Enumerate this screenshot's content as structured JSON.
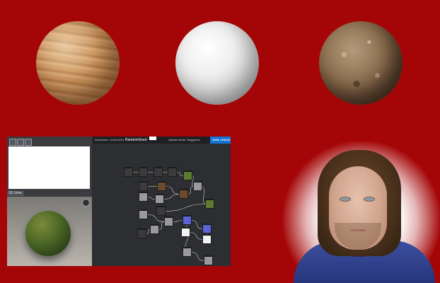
{
  "materials": [
    {
      "name": "wood",
      "icon": "wood-sphere"
    },
    {
      "name": "plaster",
      "icon": "plaster-sphere"
    },
    {
      "name": "dirt",
      "icon": "dirt-sphere"
    }
  ],
  "editor": {
    "view_3d_tab": "3D View",
    "toolbar": {
      "resolution": "Resolution: 1024x1024",
      "seed_label": "RandomSeed",
      "update_mode": "Update Mode: Staggered",
      "action_button": "100% LEACH"
    },
    "graph_nodes": [
      {
        "id": "n1",
        "thumb": "dark"
      },
      {
        "id": "n2",
        "thumb": "dark"
      },
      {
        "id": "n3",
        "thumb": "dark"
      },
      {
        "id": "n4",
        "thumb": "dark"
      },
      {
        "id": "n5",
        "thumb": "dark"
      },
      {
        "id": "n6",
        "thumb": "green"
      },
      {
        "id": "n7",
        "thumb": "gray"
      },
      {
        "id": "n8",
        "thumb": "brown"
      },
      {
        "id": "n9",
        "thumb": "gray"
      },
      {
        "id": "n10",
        "thumb": "brown"
      },
      {
        "id": "n11",
        "thumb": "gray"
      },
      {
        "id": "n12",
        "thumb": "dark"
      },
      {
        "id": "n13",
        "thumb": "green"
      },
      {
        "id": "n14",
        "thumb": "gray"
      },
      {
        "id": "n15",
        "thumb": "blue"
      },
      {
        "id": "n16",
        "thumb": "blue"
      },
      {
        "id": "n17",
        "thumb": "gray"
      },
      {
        "id": "n18",
        "thumb": "white"
      },
      {
        "id": "n19",
        "thumb": "white"
      },
      {
        "id": "n20",
        "thumb": "gray"
      },
      {
        "id": "n21",
        "thumb": "dark"
      },
      {
        "id": "n22",
        "thumb": "gray"
      },
      {
        "id": "n23",
        "thumb": "gray"
      }
    ]
  },
  "colors": {
    "background": "#a40607",
    "editor_bg": "#2c2e31",
    "accent_blue": "#1572d2"
  }
}
